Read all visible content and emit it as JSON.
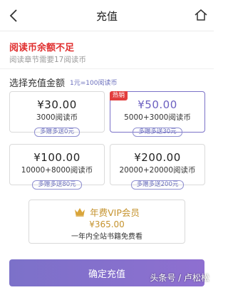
{
  "header": {
    "title": "充值",
    "back_icon": "chevron-left-icon",
    "home_icon": "home-icon"
  },
  "notice": {
    "warning": "阅读币余额不足",
    "sub": "阅读章节需要17阅读币"
  },
  "section": {
    "title": "选择充值金额",
    "rate": "1元=100阅读币"
  },
  "options": [
    {
      "price": "¥30.00",
      "coins": "3000阅读币",
      "bonus": "多赠多送0元",
      "selected": false,
      "hot": ""
    },
    {
      "price": "¥50.00",
      "coins": "5000+3000阅读币",
      "bonus": "多赠多送30元",
      "selected": true,
      "hot": "热销"
    },
    {
      "price": "¥100.00",
      "coins": "10000+8000阅读币",
      "bonus": "多赠多送80元",
      "selected": false,
      "hot": ""
    },
    {
      "price": "¥200.00",
      "coins": "20000+20000阅读币",
      "bonus": "多赠多送200元",
      "selected": false,
      "hot": ""
    }
  ],
  "vip": {
    "title": "年费VIP会员",
    "price": "¥365.00",
    "desc": "一年内全站书籍免费看",
    "icon": "crown-icon"
  },
  "confirm_label": "确定充值",
  "watermark": "头条号 / 卢松松",
  "colors": {
    "accent": "#7b72c8",
    "warning": "#e02e2e",
    "gold": "#c5932e",
    "hot": "#e23d3d"
  }
}
